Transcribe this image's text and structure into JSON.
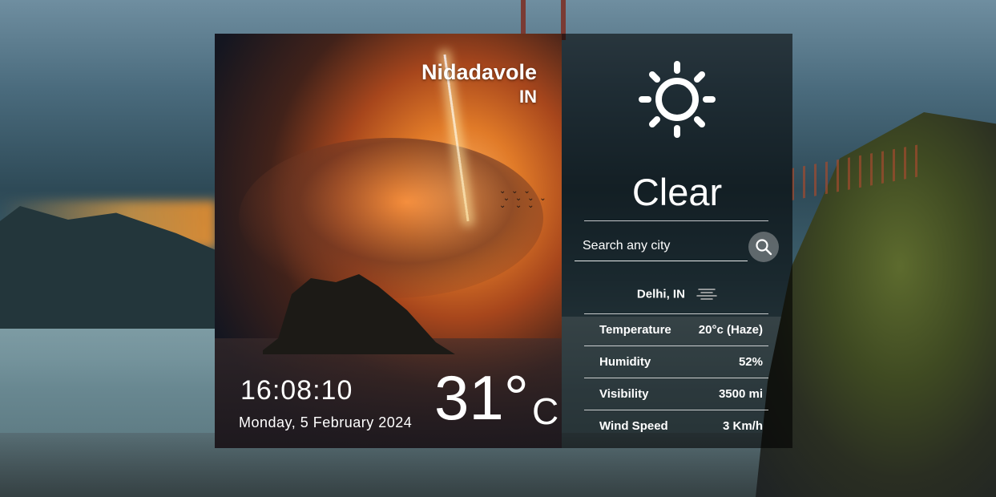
{
  "location_card": {
    "city": "Nidadavole",
    "country": "IN",
    "time": "16:08:10",
    "date": "Monday, 5 February 2024",
    "temperature": "31°",
    "unit": "C"
  },
  "weather_panel": {
    "icon": "sun-icon",
    "condition": "Clear",
    "search": {
      "placeholder": "Search any city"
    },
    "searched_location": "Delhi, IN",
    "searched_icon": "haze-icon",
    "details": [
      {
        "label": "Temperature",
        "value": "20°c (Haze)"
      },
      {
        "label": "Humidity",
        "value": "52%"
      },
      {
        "label": "Visibility",
        "value": "3500 mi"
      },
      {
        "label": "Wind Speed",
        "value": "3 Km/h"
      }
    ]
  }
}
